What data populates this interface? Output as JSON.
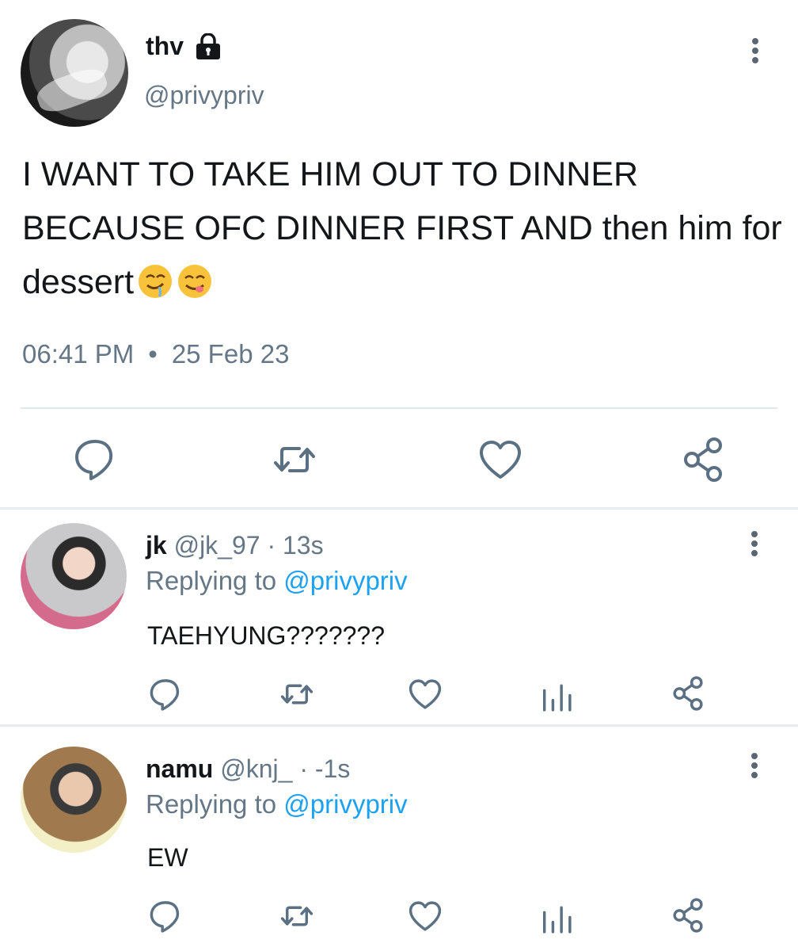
{
  "tweet": {
    "display_name": "thv",
    "handle": "@privypriv",
    "text_lines": [
      "I WANT TO TAKE HIM OUT TO DINNER",
      "BECAUSE OFC DINNER FIRST AND then him for",
      "dessert"
    ],
    "emojis": [
      "drooling-face",
      "face-savoring-food"
    ],
    "time": "06:41 PM",
    "separator": "•",
    "date": "25 Feb 23",
    "actions": [
      "reply-icon",
      "retweet-icon",
      "like-icon",
      "share-icon"
    ]
  },
  "replies": [
    {
      "name": "jk",
      "handle": "@jk_97",
      "meta": " · 13s",
      "replying_prefix": "Replying to ",
      "replying_to": "@privypriv",
      "text": "TAEHYUNG???????",
      "actions": [
        "reply-icon",
        "retweet-icon",
        "like-icon",
        "analytics-icon",
        "share-icon"
      ]
    },
    {
      "name": "namu",
      "handle": "@knj_",
      "meta": " · -1s",
      "replying_prefix": "Replying to ",
      "replying_to": "@privypriv",
      "text": "EW",
      "actions": [
        "reply-icon",
        "retweet-icon",
        "like-icon",
        "analytics-icon",
        "share-icon"
      ]
    }
  ],
  "colors": {
    "text": "#14171a",
    "secondary": "#657786",
    "link": "#1da1f2",
    "icon": "#5b7083",
    "divider": "#e6ecf0"
  }
}
